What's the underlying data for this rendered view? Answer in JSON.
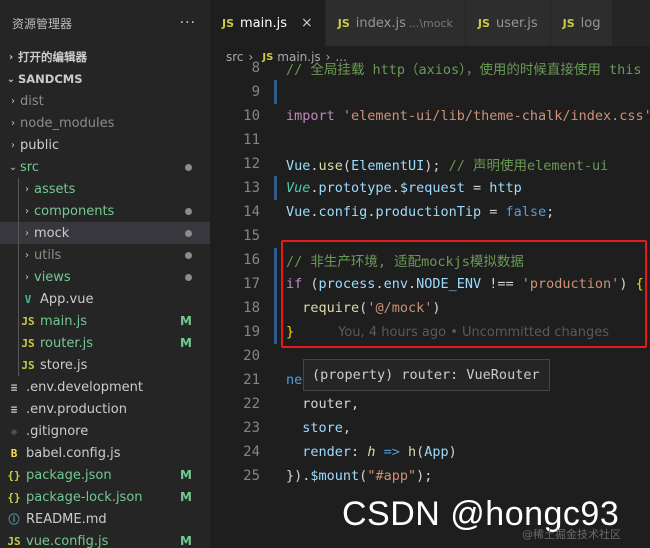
{
  "explorer": {
    "title": "资源管理器",
    "more": "···",
    "open_editors": "打开的编辑器",
    "project": "SANDCMS",
    "items": [
      {
        "label": "dist",
        "type": "folder",
        "chev": "›",
        "indent": 0,
        "icon": "",
        "muted": true
      },
      {
        "label": "node_modules",
        "type": "folder",
        "chev": "›",
        "indent": 0,
        "icon": "",
        "muted": true
      },
      {
        "label": "public",
        "type": "folder",
        "chev": "›",
        "indent": 0,
        "icon": ""
      },
      {
        "label": "src",
        "type": "folder",
        "chev": "⌄",
        "indent": 0,
        "icon": "",
        "green": true,
        "dot": true
      },
      {
        "label": "assets",
        "type": "folder",
        "chev": "›",
        "indent": 1,
        "icon": "",
        "green": true
      },
      {
        "label": "components",
        "type": "folder",
        "chev": "›",
        "indent": 1,
        "icon": "",
        "green": true,
        "dot": true
      },
      {
        "label": "mock",
        "type": "folder",
        "chev": "›",
        "indent": 1,
        "icon": "",
        "selected": true,
        "dot": true
      },
      {
        "label": "utils",
        "type": "folder",
        "chev": "›",
        "indent": 1,
        "icon": "",
        "muted": true,
        "dot": true
      },
      {
        "label": "views",
        "type": "folder",
        "chev": "›",
        "indent": 1,
        "icon": "",
        "green": true,
        "dot": true
      },
      {
        "label": "App.vue",
        "type": "file",
        "indent": 1,
        "icon": "V",
        "iconColor": "#41b883"
      },
      {
        "label": "main.js",
        "type": "file",
        "indent": 1,
        "icon": "JS",
        "iconColor": "#cbcb41",
        "green": true,
        "badge": "M"
      },
      {
        "label": "router.js",
        "type": "file",
        "indent": 1,
        "icon": "JS",
        "iconColor": "#cbcb41",
        "green": true,
        "badge": "M"
      },
      {
        "label": "store.js",
        "type": "file",
        "indent": 1,
        "icon": "JS",
        "iconColor": "#cbcb41"
      },
      {
        "label": ".env.development",
        "type": "file",
        "indent": 0,
        "icon": "≡",
        "iconColor": "#cccccc"
      },
      {
        "label": ".env.production",
        "type": "file",
        "indent": 0,
        "icon": "≡",
        "iconColor": "#cccccc"
      },
      {
        "label": ".gitignore",
        "type": "file",
        "indent": 0,
        "icon": "◆",
        "iconColor": "#41535b"
      },
      {
        "label": "babel.config.js",
        "type": "file",
        "indent": 0,
        "icon": "B",
        "iconColor": "#f5da55"
      },
      {
        "label": "package.json",
        "type": "file",
        "indent": 0,
        "icon": "{}",
        "iconColor": "#cbcb41",
        "green": true,
        "badge": "M"
      },
      {
        "label": "package-lock.json",
        "type": "file",
        "indent": 0,
        "icon": "{}",
        "iconColor": "#cbcb41",
        "green": true,
        "badge": "M"
      },
      {
        "label": "README.md",
        "type": "file",
        "indent": 0,
        "icon": "ⓘ",
        "iconColor": "#519aba"
      },
      {
        "label": "vue.config.js",
        "type": "file",
        "indent": 0,
        "icon": "JS",
        "iconColor": "#cbcb41",
        "green": true,
        "badge": "M"
      }
    ]
  },
  "tabs": [
    {
      "icon": "JS",
      "label": "main.js",
      "active": true,
      "close": "×"
    },
    {
      "icon": "JS",
      "label": "index.js",
      "hint": "...\\mock"
    },
    {
      "icon": "JS",
      "label": "user.js"
    },
    {
      "icon": "JS",
      "label": "log"
    }
  ],
  "breadcrumb": {
    "folder": "src",
    "sep": "›",
    "icon": "JS",
    "file": "main.js",
    "ellipsis": "..."
  },
  "code_lines": [
    {
      "n": "8",
      "mark": false,
      "parts": [
        [
          "c-comment",
          "// 全局挂载 http（axios），使用的时候直接使用 this"
        ]
      ]
    },
    {
      "n": "9",
      "mark": true,
      "parts": []
    },
    {
      "n": "10",
      "mark": false,
      "parts": [
        [
          "c-ctrl",
          "import "
        ],
        [
          "c-str",
          "'element-ui/lib/theme-chalk/index.css'"
        ]
      ]
    },
    {
      "n": "11",
      "mark": false,
      "parts": []
    },
    {
      "n": "12",
      "mark": false,
      "parts": [
        [
          "c-var",
          "Vue"
        ],
        [
          "",
          "."
        ],
        [
          "c-fn",
          "use"
        ],
        [
          "",
          "("
        ],
        [
          "c-var",
          "ElementUI"
        ],
        [
          "",
          "); "
        ],
        [
          "c-comment",
          "// 声明使用element-ui"
        ]
      ]
    },
    {
      "n": "13",
      "mark": true,
      "parts": [
        [
          "c-cls c-ital",
          "Vue"
        ],
        [
          "",
          "."
        ],
        [
          "c-var",
          "prototype"
        ],
        [
          "",
          "."
        ],
        [
          "c-var",
          "$request"
        ],
        [
          "",
          " = "
        ],
        [
          "c-var",
          "http"
        ]
      ]
    },
    {
      "n": "14",
      "mark": false,
      "parts": [
        [
          "c-var",
          "Vue"
        ],
        [
          "",
          "."
        ],
        [
          "c-var",
          "config"
        ],
        [
          "",
          "."
        ],
        [
          "c-var",
          "productionTip"
        ],
        [
          "",
          " = "
        ],
        [
          "c-bool",
          "false"
        ],
        [
          "",
          ";"
        ]
      ]
    },
    {
      "n": "15",
      "mark": false,
      "parts": []
    },
    {
      "n": "16",
      "mark": true,
      "parts": [
        [
          "c-comment",
          "// 非生产环境, 适配mockjs模拟数据"
        ]
      ]
    },
    {
      "n": "17",
      "mark": true,
      "parts": [
        [
          "c-ctrl",
          "if"
        ],
        [
          "",
          " ("
        ],
        [
          "c-var",
          "process"
        ],
        [
          "",
          "."
        ],
        [
          "c-var",
          "env"
        ],
        [
          "",
          "."
        ],
        [
          "c-var",
          "NODE_ENV"
        ],
        [
          "",
          " !== "
        ],
        [
          "c-str",
          "'production'"
        ],
        [
          "",
          ") "
        ],
        [
          "c-brace",
          "{"
        ]
      ]
    },
    {
      "n": "18",
      "mark": true,
      "parts": [
        [
          "",
          "  "
        ],
        [
          "c-fn",
          "require"
        ],
        [
          "",
          "("
        ],
        [
          "c-str",
          "'@/mock'"
        ],
        [
          "",
          ")"
        ]
      ]
    },
    {
      "n": "19",
      "mark": true,
      "parts": [
        [
          "c-brace",
          "}"
        ]
      ],
      "ghost": "You, 4 hours ago • Uncommitted changes"
    },
    {
      "n": "20",
      "mark": false,
      "parts": []
    },
    {
      "n": "21",
      "mark": false,
      "parts": [
        [
          "c-kw",
          "ne"
        ]
      ]
    },
    {
      "n": "22",
      "mark": false,
      "parts": [
        [
          "",
          "  "
        ],
        [
          "",
          "router"
        ],
        [
          "",
          ","
        ]
      ]
    },
    {
      "n": "23",
      "mark": false,
      "parts": [
        [
          "",
          "  "
        ],
        [
          "c-var",
          "store"
        ],
        [
          "",
          ","
        ]
      ]
    },
    {
      "n": "24",
      "mark": false,
      "parts": [
        [
          "",
          "  "
        ],
        [
          "c-var",
          "render"
        ],
        [
          "",
          ": "
        ],
        [
          "c-fn c-ital",
          "h"
        ],
        [
          "",
          " "
        ],
        [
          "c-kw",
          "=>"
        ],
        [
          "",
          " "
        ],
        [
          "c-fn",
          "h"
        ],
        [
          "",
          "("
        ],
        [
          "c-var",
          "App"
        ],
        [
          "",
          ")"
        ]
      ]
    },
    {
      "n": "25",
      "mark": false,
      "parts": [
        [
          "",
          "})."
        ],
        [
          "c-var",
          "$mount"
        ],
        [
          "",
          "("
        ],
        [
          "c-str",
          "\"#app\""
        ],
        [
          "",
          ");"
        ]
      ]
    }
  ],
  "tooltip": "(property) router: VueRouter",
  "watermark": "CSDN @hongc93",
  "watermark_sub": "@稀土掘金技术社区"
}
